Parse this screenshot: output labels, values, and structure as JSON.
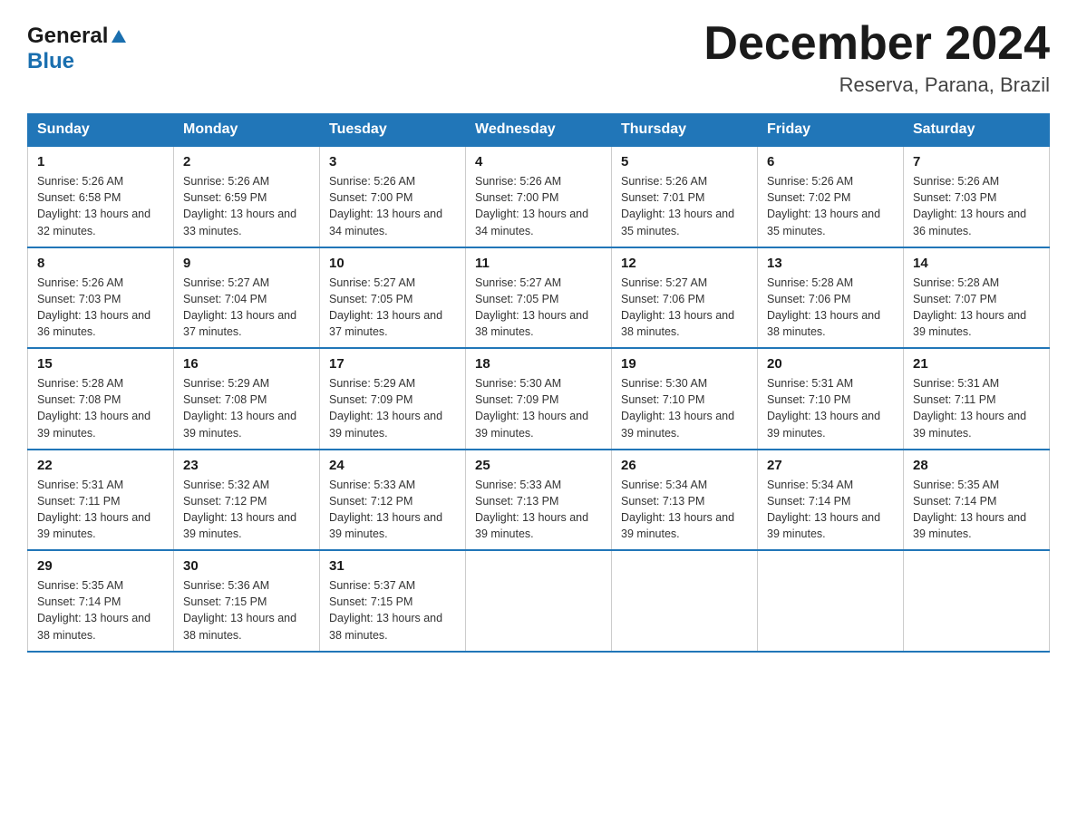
{
  "header": {
    "logo_general": "General",
    "logo_blue": "Blue",
    "title": "December 2024",
    "subtitle": "Reserva, Parana, Brazil"
  },
  "days_of_week": [
    "Sunday",
    "Monday",
    "Tuesday",
    "Wednesday",
    "Thursday",
    "Friday",
    "Saturday"
  ],
  "weeks": [
    [
      {
        "day": "1",
        "sunrise": "Sunrise: 5:26 AM",
        "sunset": "Sunset: 6:58 PM",
        "daylight": "Daylight: 13 hours and 32 minutes."
      },
      {
        "day": "2",
        "sunrise": "Sunrise: 5:26 AM",
        "sunset": "Sunset: 6:59 PM",
        "daylight": "Daylight: 13 hours and 33 minutes."
      },
      {
        "day": "3",
        "sunrise": "Sunrise: 5:26 AM",
        "sunset": "Sunset: 7:00 PM",
        "daylight": "Daylight: 13 hours and 34 minutes."
      },
      {
        "day": "4",
        "sunrise": "Sunrise: 5:26 AM",
        "sunset": "Sunset: 7:00 PM",
        "daylight": "Daylight: 13 hours and 34 minutes."
      },
      {
        "day": "5",
        "sunrise": "Sunrise: 5:26 AM",
        "sunset": "Sunset: 7:01 PM",
        "daylight": "Daylight: 13 hours and 35 minutes."
      },
      {
        "day": "6",
        "sunrise": "Sunrise: 5:26 AM",
        "sunset": "Sunset: 7:02 PM",
        "daylight": "Daylight: 13 hours and 35 minutes."
      },
      {
        "day": "7",
        "sunrise": "Sunrise: 5:26 AM",
        "sunset": "Sunset: 7:03 PM",
        "daylight": "Daylight: 13 hours and 36 minutes."
      }
    ],
    [
      {
        "day": "8",
        "sunrise": "Sunrise: 5:26 AM",
        "sunset": "Sunset: 7:03 PM",
        "daylight": "Daylight: 13 hours and 36 minutes."
      },
      {
        "day": "9",
        "sunrise": "Sunrise: 5:27 AM",
        "sunset": "Sunset: 7:04 PM",
        "daylight": "Daylight: 13 hours and 37 minutes."
      },
      {
        "day": "10",
        "sunrise": "Sunrise: 5:27 AM",
        "sunset": "Sunset: 7:05 PM",
        "daylight": "Daylight: 13 hours and 37 minutes."
      },
      {
        "day": "11",
        "sunrise": "Sunrise: 5:27 AM",
        "sunset": "Sunset: 7:05 PM",
        "daylight": "Daylight: 13 hours and 38 minutes."
      },
      {
        "day": "12",
        "sunrise": "Sunrise: 5:27 AM",
        "sunset": "Sunset: 7:06 PM",
        "daylight": "Daylight: 13 hours and 38 minutes."
      },
      {
        "day": "13",
        "sunrise": "Sunrise: 5:28 AM",
        "sunset": "Sunset: 7:06 PM",
        "daylight": "Daylight: 13 hours and 38 minutes."
      },
      {
        "day": "14",
        "sunrise": "Sunrise: 5:28 AM",
        "sunset": "Sunset: 7:07 PM",
        "daylight": "Daylight: 13 hours and 39 minutes."
      }
    ],
    [
      {
        "day": "15",
        "sunrise": "Sunrise: 5:28 AM",
        "sunset": "Sunset: 7:08 PM",
        "daylight": "Daylight: 13 hours and 39 minutes."
      },
      {
        "day": "16",
        "sunrise": "Sunrise: 5:29 AM",
        "sunset": "Sunset: 7:08 PM",
        "daylight": "Daylight: 13 hours and 39 minutes."
      },
      {
        "day": "17",
        "sunrise": "Sunrise: 5:29 AM",
        "sunset": "Sunset: 7:09 PM",
        "daylight": "Daylight: 13 hours and 39 minutes."
      },
      {
        "day": "18",
        "sunrise": "Sunrise: 5:30 AM",
        "sunset": "Sunset: 7:09 PM",
        "daylight": "Daylight: 13 hours and 39 minutes."
      },
      {
        "day": "19",
        "sunrise": "Sunrise: 5:30 AM",
        "sunset": "Sunset: 7:10 PM",
        "daylight": "Daylight: 13 hours and 39 minutes."
      },
      {
        "day": "20",
        "sunrise": "Sunrise: 5:31 AM",
        "sunset": "Sunset: 7:10 PM",
        "daylight": "Daylight: 13 hours and 39 minutes."
      },
      {
        "day": "21",
        "sunrise": "Sunrise: 5:31 AM",
        "sunset": "Sunset: 7:11 PM",
        "daylight": "Daylight: 13 hours and 39 minutes."
      }
    ],
    [
      {
        "day": "22",
        "sunrise": "Sunrise: 5:31 AM",
        "sunset": "Sunset: 7:11 PM",
        "daylight": "Daylight: 13 hours and 39 minutes."
      },
      {
        "day": "23",
        "sunrise": "Sunrise: 5:32 AM",
        "sunset": "Sunset: 7:12 PM",
        "daylight": "Daylight: 13 hours and 39 minutes."
      },
      {
        "day": "24",
        "sunrise": "Sunrise: 5:33 AM",
        "sunset": "Sunset: 7:12 PM",
        "daylight": "Daylight: 13 hours and 39 minutes."
      },
      {
        "day": "25",
        "sunrise": "Sunrise: 5:33 AM",
        "sunset": "Sunset: 7:13 PM",
        "daylight": "Daylight: 13 hours and 39 minutes."
      },
      {
        "day": "26",
        "sunrise": "Sunrise: 5:34 AM",
        "sunset": "Sunset: 7:13 PM",
        "daylight": "Daylight: 13 hours and 39 minutes."
      },
      {
        "day": "27",
        "sunrise": "Sunrise: 5:34 AM",
        "sunset": "Sunset: 7:14 PM",
        "daylight": "Daylight: 13 hours and 39 minutes."
      },
      {
        "day": "28",
        "sunrise": "Sunrise: 5:35 AM",
        "sunset": "Sunset: 7:14 PM",
        "daylight": "Daylight: 13 hours and 39 minutes."
      }
    ],
    [
      {
        "day": "29",
        "sunrise": "Sunrise: 5:35 AM",
        "sunset": "Sunset: 7:14 PM",
        "daylight": "Daylight: 13 hours and 38 minutes."
      },
      {
        "day": "30",
        "sunrise": "Sunrise: 5:36 AM",
        "sunset": "Sunset: 7:15 PM",
        "daylight": "Daylight: 13 hours and 38 minutes."
      },
      {
        "day": "31",
        "sunrise": "Sunrise: 5:37 AM",
        "sunset": "Sunset: 7:15 PM",
        "daylight": "Daylight: 13 hours and 38 minutes."
      },
      null,
      null,
      null,
      null
    ]
  ]
}
